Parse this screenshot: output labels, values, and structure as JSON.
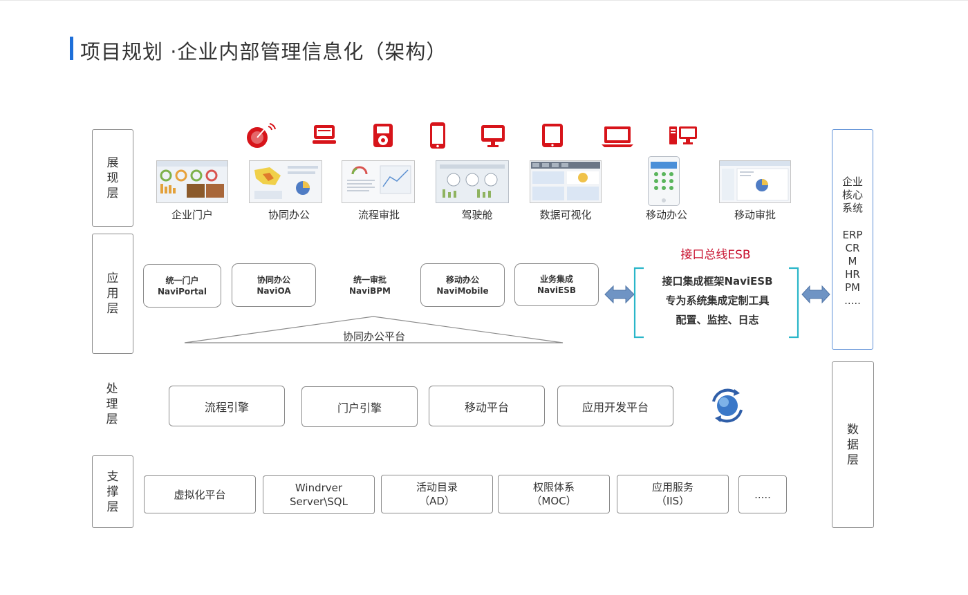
{
  "page": {
    "title": "项目规划 ·企业内部管理信息化（架构）"
  },
  "layers": {
    "presentation": [
      "展",
      "现",
      "层"
    ],
    "application": [
      "应",
      "用",
      "层"
    ],
    "processing": [
      "处",
      "理",
      "层"
    ],
    "support": [
      "支",
      "撑",
      "层"
    ]
  },
  "device_icons": [
    "satellite-dish-icon",
    "laptop-icon",
    "media-player-icon",
    "smartphone-icon",
    "desktop-icon",
    "tablet-icon",
    "notebook-icon",
    "pc-monitor-icon"
  ],
  "presentation_items": [
    "企业门户",
    "协同办公",
    "流程审批",
    "驾驶舱",
    "数据可视化",
    "移动办公",
    "移动审批"
  ],
  "application_items": [
    {
      "line1": "统一门户",
      "line2": "NaviPortal"
    },
    {
      "line1": "协同办公",
      "line2": "NaviOA"
    },
    {
      "line1": "统一审批",
      "line2": "NaviBPM"
    },
    {
      "line1": "移动办公",
      "line2": "NaviMobile"
    },
    {
      "line1": "业务集成",
      "line2": "NaviESB"
    }
  ],
  "platform_label": "协同办公平台",
  "esb": {
    "title": "接口总线ESB",
    "lines": [
      "接口集成框架NaviESB",
      "专为系统集成定制工具",
      "配置、监控、日志"
    ]
  },
  "core_systems": {
    "title": [
      "企业",
      "核心",
      "系统"
    ],
    "items": [
      "ERP",
      "CR",
      "M",
      "HR",
      "PM",
      "....."
    ]
  },
  "data_layer": [
    "数",
    "据",
    "层"
  ],
  "processing_items": [
    "流程引擎",
    "门户引擎",
    "移动平台",
    "应用开发平台"
  ],
  "support_items": [
    {
      "line1": "虚拟化平台",
      "line2": ""
    },
    {
      "line1": "Windrver",
      "line2": "Server\\SQL"
    },
    {
      "line1": "活动目录",
      "line2": "（AD）"
    },
    {
      "line1": "权限体系",
      "line2": "（MOC）"
    },
    {
      "line1": "应用服务",
      "line2": "（IIS）"
    },
    {
      "line1": ".....",
      "line2": ""
    }
  ],
  "colors": {
    "accent": "#1e6fd9",
    "device_red": "#d7141a",
    "esb_red": "#c8102e",
    "esb_bracket": "#29b6c9",
    "arrow_blue": "#6f94c4",
    "core_border": "#5b8ed6"
  }
}
